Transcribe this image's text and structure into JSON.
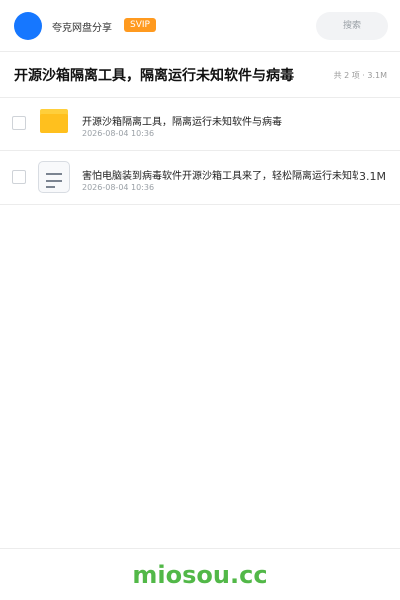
{
  "header": {
    "brand": "夸克网盘分享",
    "badge": "SVIP",
    "search_placeholder": "搜索"
  },
  "share": {
    "title": "开源沙箱隔离工具，隔离运行未知软件与病毒",
    "meta": "共 2 项 · 3.1M"
  },
  "files": [
    {
      "icon": "folder-icon",
      "name": "开源沙箱隔离工具，隔离运行未知软件与病毒",
      "date": "2026-08-04 10:36",
      "size": ""
    },
    {
      "icon": "document-icon",
      "name": "害怕电脑装到病毒软件开源沙箱工具来了，轻松隔离运行未知软件",
      "date": "2026-08-04 10:36",
      "size": "3.1M"
    }
  ],
  "footer": {
    "logo": "miosou.cc"
  },
  "colors": {
    "accent": "#1677ff",
    "badge": "#ff9a1f",
    "folder": "#ffc01e",
    "logo": "#52b848"
  }
}
